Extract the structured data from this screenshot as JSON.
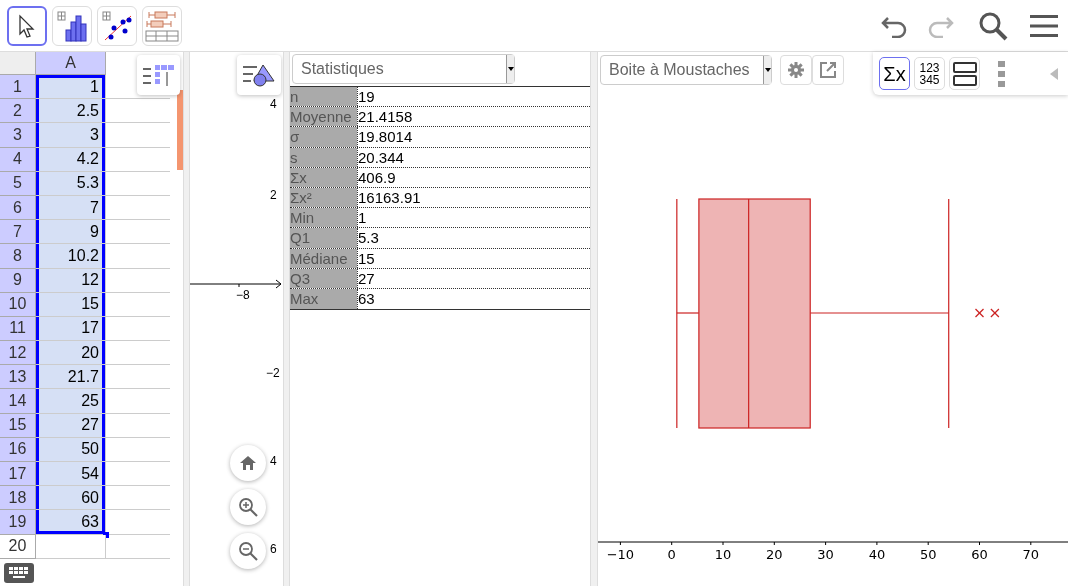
{
  "toolbar": {
    "tools": [
      {
        "kind": "move",
        "selected": true
      },
      {
        "kind": "histogram",
        "selected": false
      },
      {
        "kind": "regression",
        "selected": false
      },
      {
        "kind": "boxplot",
        "selected": false
      }
    ],
    "history": [
      {
        "kind": "undo",
        "disabled": false
      },
      {
        "kind": "redo",
        "disabled": true
      }
    ]
  },
  "spreadsheet": {
    "columns": [
      "A"
    ],
    "rows": [
      {
        "label": "1",
        "value": "1",
        "selected": true
      },
      {
        "label": "2",
        "value": "2.5",
        "selected": true
      },
      {
        "label": "3",
        "value": "3",
        "selected": true
      },
      {
        "label": "4",
        "value": "4.2",
        "selected": true
      },
      {
        "label": "5",
        "value": "5.3",
        "selected": true
      },
      {
        "label": "6",
        "value": "7",
        "selected": true
      },
      {
        "label": "7",
        "value": "9",
        "selected": true
      },
      {
        "label": "8",
        "value": "10.2",
        "selected": true
      },
      {
        "label": "9",
        "value": "12",
        "selected": true
      },
      {
        "label": "10",
        "value": "15",
        "selected": true
      },
      {
        "label": "11",
        "value": "17",
        "selected": true
      },
      {
        "label": "12",
        "value": "20",
        "selected": true
      },
      {
        "label": "13",
        "value": "21.7",
        "selected": true
      },
      {
        "label": "14",
        "value": "25",
        "selected": true
      },
      {
        "label": "15",
        "value": "27",
        "selected": true
      },
      {
        "label": "16",
        "value": "50",
        "selected": true
      },
      {
        "label": "17",
        "value": "54",
        "selected": true
      },
      {
        "label": "18",
        "value": "60",
        "selected": true
      },
      {
        "label": "19",
        "value": "63",
        "selected": true
      },
      {
        "label": "20",
        "selected": false
      }
    ]
  },
  "graphics": {
    "labels": [
      "4",
      "2",
      "−8",
      "−2",
      "4",
      "6"
    ]
  },
  "statistics": {
    "dropdown": "Statistiques",
    "rows": [
      {
        "name": "n",
        "value": "19"
      },
      {
        "name": "Moyenne",
        "value": "21.4158"
      },
      {
        "name": "σ",
        "value": "19.8014"
      },
      {
        "name": "s",
        "value": "20.344"
      },
      {
        "name": "Σx",
        "value": "406.9"
      },
      {
        "name": "Σx²",
        "value": "16163.91"
      },
      {
        "name": "Min",
        "value": "1"
      },
      {
        "name": "Q1",
        "value": "5.3"
      },
      {
        "name": "Médiane",
        "value": "15"
      },
      {
        "name": "Q3",
        "value": "27"
      },
      {
        "name": "Max",
        "value": "63"
      }
    ]
  },
  "plot": {
    "dropdown": "Boite à Moustaches",
    "view_buttons": [
      {
        "kind": "sum",
        "lines": [
          "Σx"
        ],
        "selected": true
      },
      {
        "kind": "numbers",
        "lines": [
          "123",
          "345"
        ],
        "selected": false
      },
      {
        "kind": "layout",
        "selected": false
      }
    ],
    "x_ticks": [
      "−10",
      "0",
      "10",
      "20",
      "30",
      "40",
      "50",
      "60",
      "70"
    ]
  }
}
